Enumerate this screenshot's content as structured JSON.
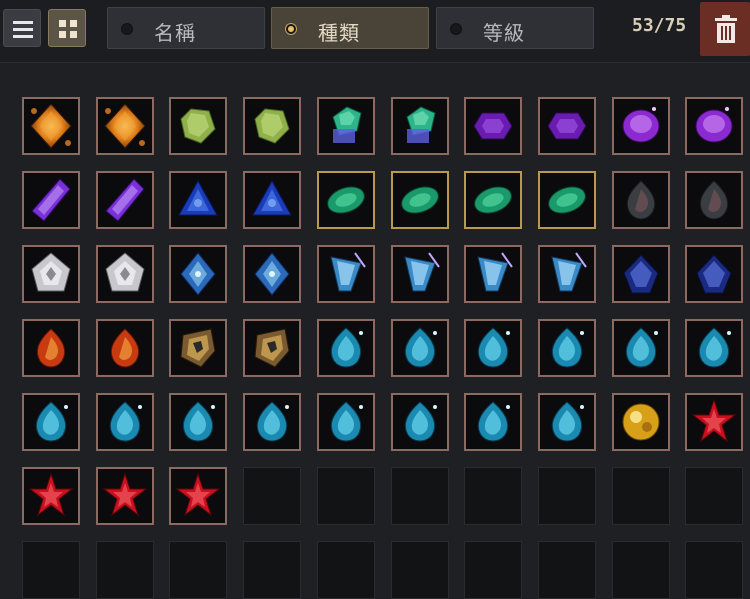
{
  "tabs": [
    {
      "label": "名稱",
      "active": false
    },
    {
      "label": "種類",
      "active": true
    },
    {
      "label": "等級",
      "active": false
    }
  ],
  "count": "53/75",
  "icons": {
    "list": "list-icon",
    "grid": "grid-icon",
    "trash": "trash-icon"
  },
  "colors": {
    "slot_border": "#8c6a62",
    "slot_border_selected": "#b89a4e",
    "tab_active_dot": "#e6c06a",
    "trash_bg": "#6a2e24"
  },
  "inventory": {
    "capacity": 75,
    "filled": 53,
    "items": [
      {
        "gem": "amber-diamond"
      },
      {
        "gem": "amber-diamond"
      },
      {
        "gem": "green-peridot"
      },
      {
        "gem": "green-peridot"
      },
      {
        "gem": "emerald-cluster"
      },
      {
        "gem": "emerald-cluster"
      },
      {
        "gem": "violet-hexagon"
      },
      {
        "gem": "violet-hexagon"
      },
      {
        "gem": "violet-oval"
      },
      {
        "gem": "violet-oval"
      },
      {
        "gem": "amethyst-shard"
      },
      {
        "gem": "amethyst-shard"
      },
      {
        "gem": "sapphire-trillion"
      },
      {
        "gem": "sapphire-trillion"
      },
      {
        "gem": "emerald-marquise",
        "selected": true
      },
      {
        "gem": "emerald-marquise",
        "selected": true
      },
      {
        "gem": "emerald-marquise",
        "selected": true
      },
      {
        "gem": "emerald-marquise",
        "selected": true
      },
      {
        "gem": "smoky-teardrop"
      },
      {
        "gem": "smoky-teardrop"
      },
      {
        "gem": "white-diamond"
      },
      {
        "gem": "white-diamond"
      },
      {
        "gem": "blue-octahedron"
      },
      {
        "gem": "blue-octahedron"
      },
      {
        "gem": "ice-crystal"
      },
      {
        "gem": "ice-crystal"
      },
      {
        "gem": "ice-crystal"
      },
      {
        "gem": "ice-crystal"
      },
      {
        "gem": "navy-crystal"
      },
      {
        "gem": "navy-crystal"
      },
      {
        "gem": "fire-teardrop"
      },
      {
        "gem": "fire-teardrop"
      },
      {
        "gem": "topaz-cluster"
      },
      {
        "gem": "topaz-cluster"
      },
      {
        "gem": "aqua-teardrop"
      },
      {
        "gem": "aqua-teardrop"
      },
      {
        "gem": "aqua-teardrop"
      },
      {
        "gem": "aqua-teardrop"
      },
      {
        "gem": "aqua-teardrop"
      },
      {
        "gem": "aqua-teardrop"
      },
      {
        "gem": "aqua-teardrop"
      },
      {
        "gem": "aqua-teardrop"
      },
      {
        "gem": "aqua-teardrop"
      },
      {
        "gem": "aqua-teardrop"
      },
      {
        "gem": "aqua-teardrop"
      },
      {
        "gem": "aqua-teardrop"
      },
      {
        "gem": "aqua-teardrop"
      },
      {
        "gem": "aqua-teardrop"
      },
      {
        "gem": "gold-nugget"
      },
      {
        "gem": "ruby-star"
      },
      {
        "gem": "ruby-star"
      },
      {
        "gem": "ruby-star"
      },
      {
        "gem": "ruby-star"
      }
    ]
  }
}
